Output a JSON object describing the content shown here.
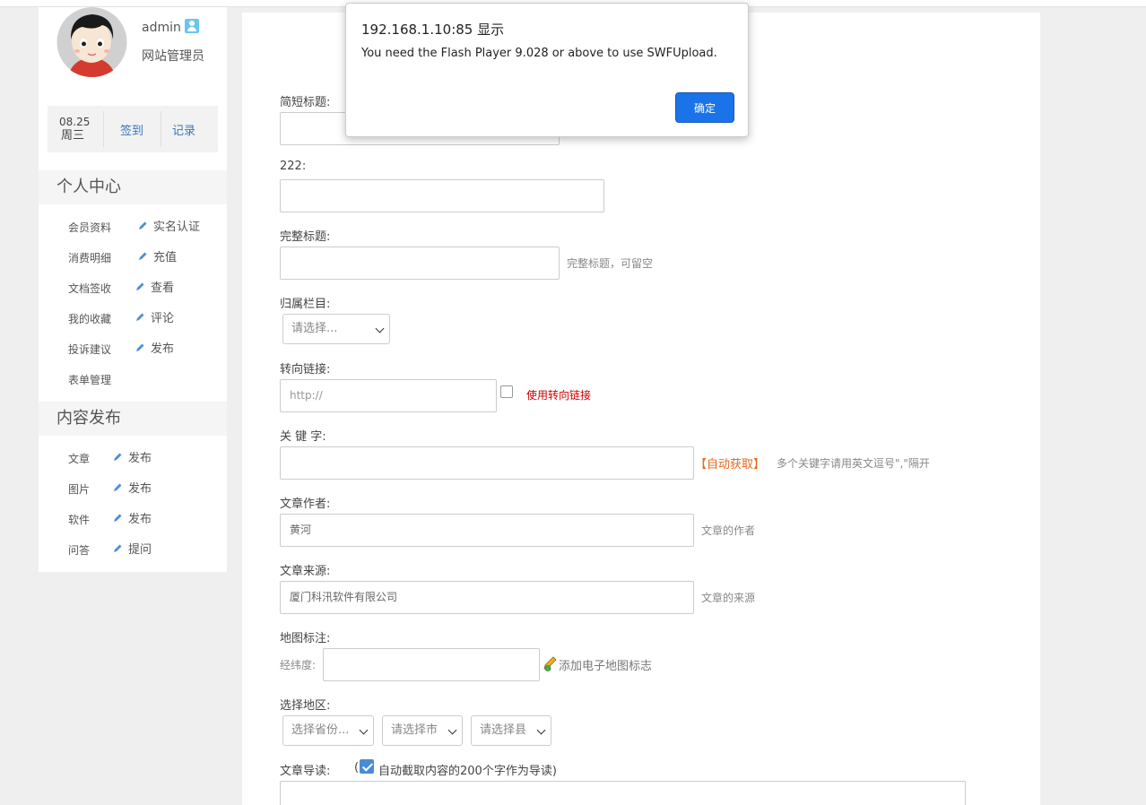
{
  "user": {
    "name": "admin",
    "role": "网站管理员"
  },
  "signin": {
    "date": "08.25",
    "weekday": "周三",
    "sign_label": "签到",
    "record_label": "记录"
  },
  "personal": {
    "title": "个人中心",
    "rows": [
      {
        "left": "会员资料",
        "right": "实名认证"
      },
      {
        "left": "消费明细",
        "right": "充值"
      },
      {
        "left": "文档签收",
        "right": "查看"
      },
      {
        "left": "我的收藏",
        "right": "评论"
      },
      {
        "left": "投诉建议",
        "right": "发布"
      },
      {
        "left": "表单管理",
        "right": ""
      }
    ]
  },
  "content": {
    "title": "内容发布",
    "rows": [
      {
        "left": "文章",
        "right": "发布"
      },
      {
        "left": "图片",
        "right": "发布"
      },
      {
        "left": "软件",
        "right": "发布"
      },
      {
        "left": "问答",
        "right": "提问"
      }
    ]
  },
  "form": {
    "short_title": {
      "label": "简短标题:"
    },
    "f222": {
      "label": "222:"
    },
    "full_title": {
      "label": "完整标题:",
      "hint": "完整标题，可留空"
    },
    "category": {
      "label": "归属栏目:",
      "value": "请选择..."
    },
    "redirect": {
      "label": "转向链接:",
      "placeholder": "http://",
      "check_label": "使用转向链接"
    },
    "keywords": {
      "label": "关 键 字:",
      "auto": "【自动获取】",
      "hint": "多个关键字请用英文逗号\",\"隔开"
    },
    "author": {
      "label": "文章作者:",
      "value": "黄河",
      "hint": "文章的作者"
    },
    "source": {
      "label": "文章来源:",
      "value": "厦门科汛软件有限公司",
      "hint": "文章的来源"
    },
    "map": {
      "label": "地图标注:",
      "sub": "经纬度:",
      "add": "添加电子地图标志"
    },
    "region": {
      "label": "选择地区:",
      "province": "选择省份...",
      "city": "请选择市",
      "county": "请选择县"
    },
    "intro": {
      "label": "文章导读:",
      "paren_open": "(",
      "auto_text": "自动截取内容的200个字作为导读)"
    }
  },
  "alert": {
    "origin": "192.168.1.10:85 显示",
    "message": "You need the Flash Player 9.028 or above to use SWFUpload.",
    "ok": "确定"
  },
  "colors": {
    "accent_blue": "#1a73e8",
    "link_blue": "#3a77b8",
    "auto_orange": "#e8661a",
    "redirect_red": "#cc0000"
  }
}
